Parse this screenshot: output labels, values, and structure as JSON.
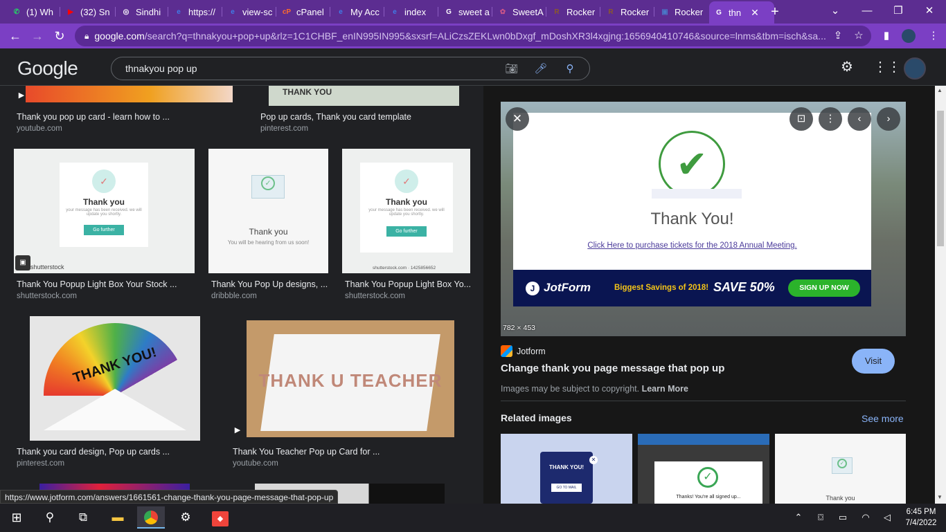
{
  "browser": {
    "tabs": [
      {
        "label": "(1) Wh",
        "icon": "whatsapp-icon",
        "color": "#25d366",
        "glyph": "✆"
      },
      {
        "label": "(32) Sn",
        "icon": "youtube-icon",
        "color": "#ff0000",
        "glyph": "▶"
      },
      {
        "label": "Sindhi",
        "icon": "globe-icon",
        "color": "#ffffff",
        "glyph": "◎"
      },
      {
        "label": "https://",
        "icon": "edge-e-icon",
        "color": "#3f7de8",
        "glyph": "e"
      },
      {
        "label": "view-sc",
        "icon": "edge-e-icon",
        "color": "#3f7de8",
        "glyph": "e"
      },
      {
        "label": "cPanel",
        "icon": "cpanel-icon",
        "color": "#ff6c2c",
        "glyph": "cP"
      },
      {
        "label": "My Acc",
        "icon": "edge-e-icon",
        "color": "#3f7de8",
        "glyph": "e"
      },
      {
        "label": "index",
        "icon": "edge-e-icon",
        "color": "#3f7de8",
        "glyph": "e"
      },
      {
        "label": "sweet a",
        "icon": "google-g-icon",
        "color": "#ffffff",
        "glyph": "G"
      },
      {
        "label": "SweetA",
        "icon": "sweet-icon",
        "color": "#c58",
        "glyph": "✿"
      },
      {
        "label": "Rocker",
        "icon": "rocker-icon",
        "color": "#8a5a2a",
        "glyph": "R"
      },
      {
        "label": "Rocker",
        "icon": "rocker-icon",
        "color": "#8a5a2a",
        "glyph": "R"
      },
      {
        "label": "Rocker",
        "icon": "browser-tab-icon",
        "color": "#4a78c8",
        "glyph": "▣"
      },
      {
        "label": "thn",
        "icon": "google-g-icon",
        "color": "#ffffff",
        "glyph": "G"
      }
    ],
    "address": {
      "domain": "google.com",
      "rest": "/search?q=thnakyou+pop+up&rlz=1C1CHBF_enIN995IN995&sxsrf=ALiCzsZEKLwn0bDxgf_mDoshXR3l4xgjng:1656940410746&source=lnms&tbm=isch&sa..."
    },
    "status_url": "https://www.jotform.com/answers/1661561-change-thank-you-page-message-that-pop-up"
  },
  "google": {
    "logo": "Google",
    "query": "thnakyou pop up"
  },
  "results": [
    {
      "caption": "Thank you pop up card - learn how to ...",
      "source": "youtube.com",
      "thumb_text": ""
    },
    {
      "caption": "Pop up cards, Thank you card template",
      "source": "pinterest.com",
      "thumb_text": "THANK YOU"
    },
    {
      "caption": "Thank You Popup Light Box Your Stock ...",
      "source": "shutterstock.com",
      "thumb_title": "Thank you",
      "thumb_body": "your message has been received. we will update you shortly.",
      "thumb_button": "Go further",
      "thumb_brand": "shutterstock"
    },
    {
      "caption": "Thank You Pop Up designs, ...",
      "source": "dribbble.com",
      "thumb_title": "Thank you",
      "thumb_body": "You will be hearing from us soon!"
    },
    {
      "caption": "Thank You Popup Light Box Yo...",
      "source": "shutterstock.com",
      "thumb_title": "Thank you",
      "thumb_body": "your message has been received. we will update you shortly.",
      "thumb_button": "Go further",
      "thumb_brand": "shutterstock.com · 1425856652"
    },
    {
      "caption": "Thank you card design, Pop up cards ...",
      "source": "pinterest.com",
      "thumb_text": "THANK YOU!"
    },
    {
      "caption": "Thank You Teacher Pop up Card for ...",
      "source": "youtube.com",
      "thumb_text": "THANK U TEACHER"
    }
  ],
  "panel": {
    "preview": {
      "heading": "Thank You!",
      "link": "Click Here to purchase tickets for the 2018 Annual Meeting.",
      "jotform_logo": "JotForm",
      "promo": "Biggest Savings of 2018!",
      "save": "SAVE 50%",
      "signup": "SIGN UP NOW",
      "dims": "782 × 453"
    },
    "site": "Jotform",
    "title": "Change thank you page message that pop up",
    "copyright": "Images may be subject to copyright.",
    "learn_more": "Learn More",
    "visit": "Visit",
    "related_heading": "Related images",
    "see_more": "See more",
    "related": [
      {
        "title": "THANK YOU!",
        "button": "GO TO MAIL"
      },
      {
        "title": "Thanks! You're all signed up..."
      },
      {
        "title": "Thank you"
      }
    ]
  },
  "taskbar": {
    "time": "6:45 PM",
    "date": "7/4/2022"
  }
}
